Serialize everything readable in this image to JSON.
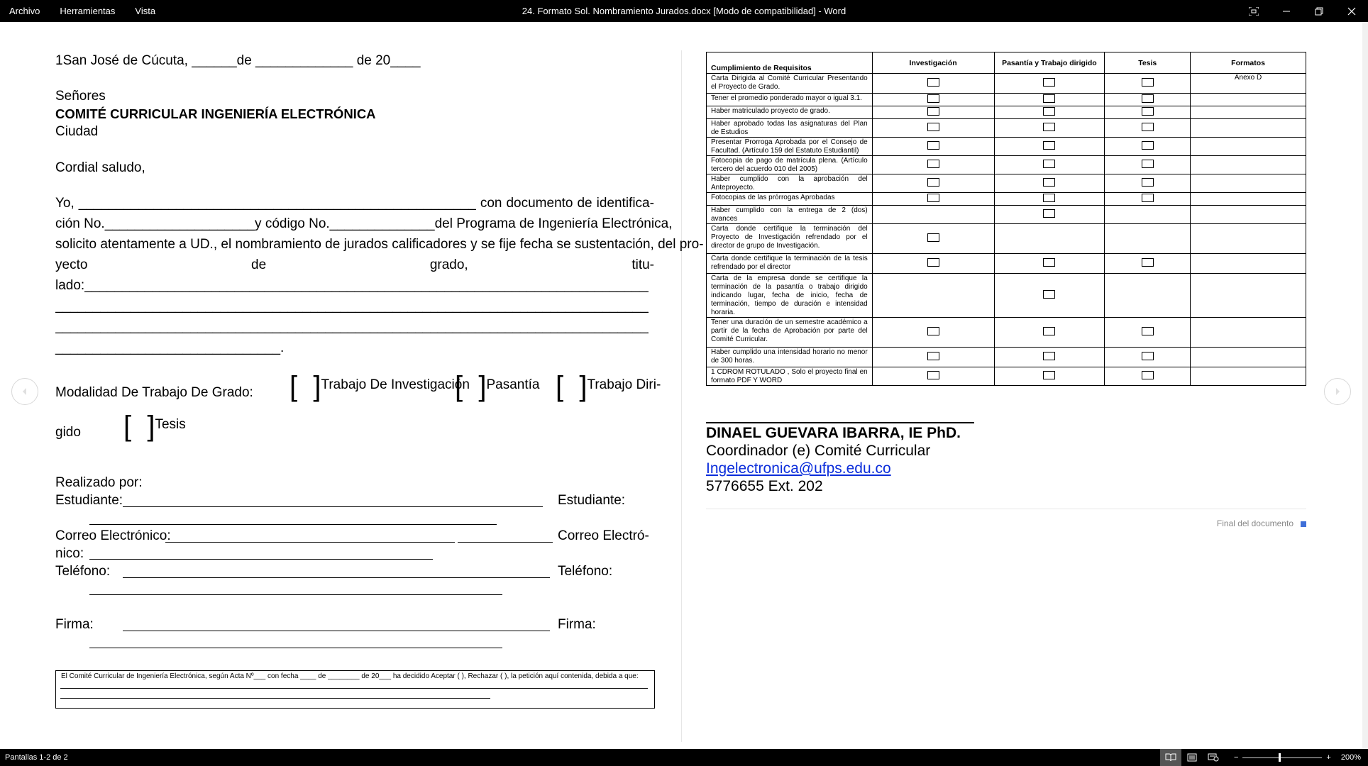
{
  "menu": {
    "file": "Archivo",
    "tools": "Herramientas",
    "view": "Vista"
  },
  "window": {
    "title": "24. Formato Sol. Nombramiento Jurados.docx [Modo de compatibilidad]  -  Word"
  },
  "page1": {
    "date_line": "1San José de Cúcuta, ______de _____________ de 20____",
    "salutation_to": "Señores",
    "committee": "COMITÉ CURRICULAR  INGENIERÍA ELECTRÓNICA",
    "city": "Ciudad",
    "greeting": "Cordial saludo,",
    "body_l1": [
      "Yo,",
      "_____________________________________________________",
      "con",
      "documento",
      "de",
      "identifica-"
    ],
    "body_l2": [
      "ción No.",
      "____________________",
      "y código No.______________",
      "del Programa de Ingeniería Electrónica,"
    ],
    "body_l3": [
      "solicito atentamente a UD., el nombramiento de jurados calificadores y se fije fecha se sustentación, del pro-"
    ],
    "body_l4": [
      "yecto",
      "de",
      "grado,",
      "titu-"
    ],
    "body_l5": "lado:_______________________________________________________________________________",
    "body_l6": "________________________________________________________________________________",
    "body_l7": "________________________________________________________________________________",
    "body_l8": "______________________________.",
    "modality_label": "Modalidad De Trabajo De Grado:",
    "mod_investigation": "Trabajo De Investigación",
    "mod_internship": "Pasantía",
    "mod_directed": "Trabajo Diri-",
    "mod_directed_2": "gido",
    "mod_thesis": "Tesis",
    "done_by": "Realizado por:",
    "student": "Estudiante:",
    "email": "Correo Electrónico:",
    "email_right": "Correo Electró-",
    "email_right_2": "nico:",
    "phone": "Teléfono:",
    "signature": "Firma:",
    "committee_note": "El Comité Curricular de Ingeniería Electrónica, según Acta Nº___ con fecha ____ de ________ de 20___ ha decidido Aceptar (   ), Rechazar (  ), la petición aquí contenida, debida a que:"
  },
  "table": {
    "headers": [
      "Cumplimiento de Requisitos",
      "Investigación",
      "Pasantía y Trabajo dirigido",
      "Tesis",
      "Formatos"
    ],
    "rows": [
      {
        "req": "Carta Dirigida al Comité Curricular Presentando el Proyecto de Grado.",
        "inv": true,
        "pas": true,
        "tes": true,
        "fmt": "Anexo D"
      },
      {
        "req": "Tener el promedio ponderado mayor o igual 3.1.",
        "inv": true,
        "pas": true,
        "tes": true,
        "fmt": ""
      },
      {
        "req": "Haber matriculado proyecto de grado.",
        "inv": true,
        "pas": true,
        "tes": true,
        "fmt": ""
      },
      {
        "req": "Haber aprobado todas las asignaturas del Plan de Estudios",
        "inv": true,
        "pas": true,
        "tes": true,
        "fmt": ""
      },
      {
        "req": "Presentar Prorroga Aprobada por el Consejo de Facultad. (Artículo 159 del Estatuto Estudiantil)",
        "inv": true,
        "pas": true,
        "tes": true,
        "fmt": ""
      },
      {
        "req": "Fotocopia de pago de matrícula plena. (Artículo tercero del acuerdo 010 del 2005)",
        "inv": true,
        "pas": true,
        "tes": true,
        "fmt": ""
      },
      {
        "req": "Haber cumplido con la aprobación del Anteproyecto.",
        "inv": true,
        "pas": true,
        "tes": true,
        "fmt": ""
      },
      {
        "req": "Fotocopias de las prórrogas Aprobadas",
        "inv": true,
        "pas": true,
        "tes": true,
        "fmt": ""
      },
      {
        "req": "Haber cumplido con la entrega de 2 (dos) avances",
        "inv": false,
        "pas": true,
        "tes": false,
        "fmt": ""
      },
      {
        "req": "Carta donde certifique la terminación del Proyecto de Investigación refrendado por el director de grupo de Investigación.",
        "inv": true,
        "pas": false,
        "tes": false,
        "fmt": ""
      },
      {
        "req": "Carta donde certifique la terminación de la tesis refrendado por el director",
        "inv": true,
        "pas": true,
        "tes": true,
        "fmt": ""
      },
      {
        "req": "Carta de la empresa donde se certifique la terminación de la pasantía o trabajo dirigido indicando lugar, fecha de inicio, fecha de terminación, tiempo de duración e intensidad horaria.",
        "inv": false,
        "pas": true,
        "tes": false,
        "fmt": ""
      },
      {
        "req": "Tener una duración de un semestre académico a partir de la fecha de Aprobación por parte del Comité Curricular.",
        "inv": true,
        "pas": true,
        "tes": true,
        "fmt": ""
      },
      {
        "req": "Haber cumplido una intensidad horario no menor de 300 horas.",
        "inv": true,
        "pas": true,
        "tes": true,
        "fmt": ""
      },
      {
        "req": "1 CDROM ROTULADO , Solo el proyecto  final en formato PDF Y WORD",
        "inv": true,
        "pas": true,
        "tes": true,
        "fmt": ""
      }
    ]
  },
  "signatory": {
    "name": "DINAEL GUEVARA IBARRA, IE PhD.",
    "role": "Coordinador (e) Comité Curricular",
    "email": "Ingelectronica@ufps.edu.co",
    "phone": "5776655 Ext. 202"
  },
  "end_of_doc": "Final del documento",
  "status": {
    "screens": "Pantallas 1-2 de 2",
    "zoom": "200%"
  },
  "colors": {
    "accent": "#3f6fd8",
    "link": "#0b2ddb"
  }
}
